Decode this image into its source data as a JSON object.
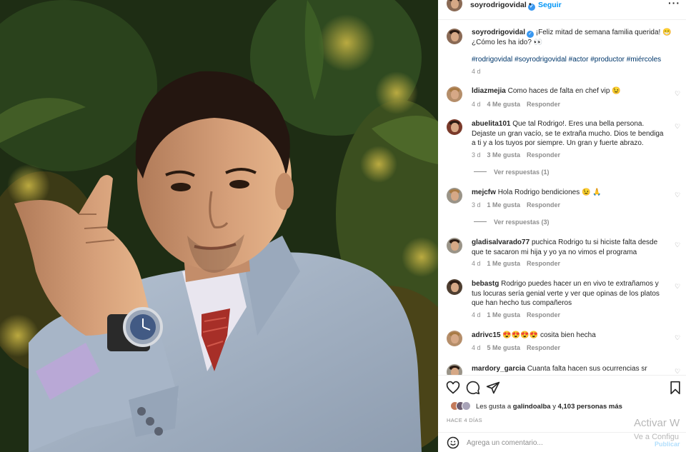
{
  "header": {
    "username": "soyrodrigovidal",
    "follow_label": "Seguir",
    "more_icon": "more-horizontal-icon"
  },
  "caption": {
    "username": "soyrodrigovidal",
    "text": "¡Feliz mitad de semana familia querida! 😁 ¿Cómo les ha ido? 👀",
    "hashtags": "#rodrigovidal #soyrodrigovidal #actor #productor #miércoles",
    "time": "4 d"
  },
  "comments": [
    {
      "username": "ldiazmejia",
      "text": "Como haces de falta en chef vip 😉",
      "time": "4 d",
      "likes": "4 Me gusta",
      "reply": "Responder"
    },
    {
      "username": "abuelita101",
      "text": "Que tal Rodrigo!. Eres una bella persona. Dejaste un gran vacío, se te extraña mucho. Dios te bendiga a ti y a los tuyos por siempre. Un gran y fuerte abrazo.",
      "time": "3 d",
      "likes": "3 Me gusta",
      "reply": "Responder",
      "view_replies": "Ver respuestas (1)"
    },
    {
      "username": "mejcfw",
      "text": "Hola Rodrigo bendiciones 😉 🙏",
      "time": "3 d",
      "likes": "1 Me gusta",
      "reply": "Responder",
      "view_replies": "Ver respuestas (3)"
    },
    {
      "username": "gladisalvarado77",
      "text": "puchica Rodrigo tu si hiciste falta desde que te sacaron mi hija y yo ya no vimos el programa",
      "time": "4 d",
      "likes": "1 Me gusta",
      "reply": "Responder"
    },
    {
      "username": "bebastg",
      "text": "Rodrigo puedes hacer un en vivo te extrañamos y tus locuras sería genial verte y ver que opinas de los platos que han hecho tus compañeros",
      "time": "4 d",
      "likes": "1 Me gusta",
      "reply": "Responder"
    },
    {
      "username": "adrivc15",
      "text": "😍😍😍😍 cosita bien hecha",
      "time": "4 d",
      "likes": "5 Me gusta",
      "reply": "Responder"
    },
    {
      "username": "mardory_garcia",
      "text": "Cuanta falta hacen sus ocurrencias sr"
    }
  ],
  "likes_line": {
    "prefix": "Les gusta a ",
    "user": "galindoalba",
    "middle": " y ",
    "count": "4,103 personas más"
  },
  "posted_ago": "HACE 4 DÍAS",
  "add_comment": {
    "emoji_icon": "smiley-icon",
    "placeholder": "Agrega un comentario...",
    "publish_label": "Publicar"
  },
  "watermark": {
    "line1": "Activar W",
    "line2": "Ve a Configu"
  },
  "colors": {
    "link_blue": "#0095f6",
    "hashtag_blue": "#00376b",
    "muted": "#8e8e8e",
    "verified": "#3897f0"
  }
}
